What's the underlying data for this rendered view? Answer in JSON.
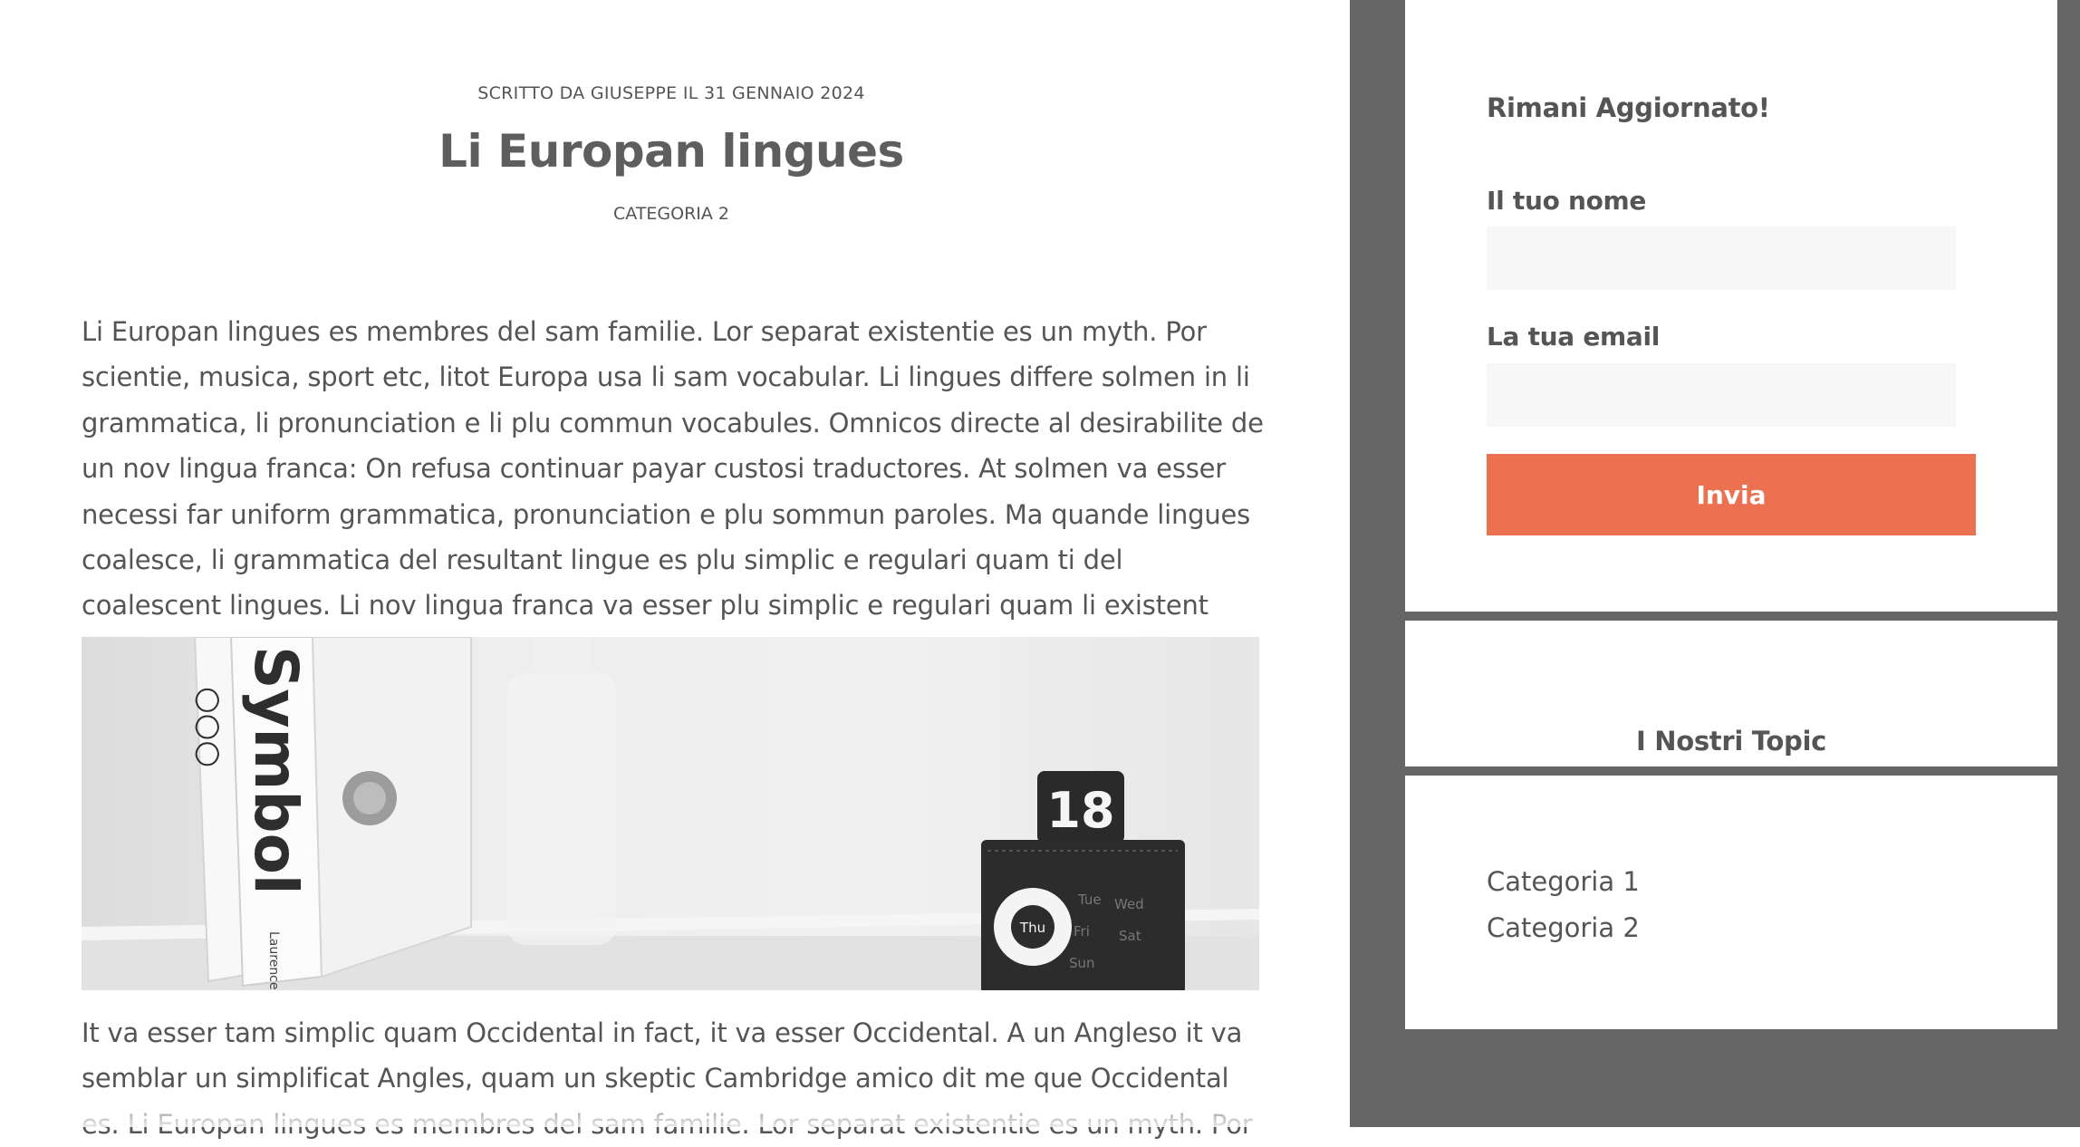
{
  "post": {
    "byline": "SCRITTO DA GIUSEPPE IL 31 GENNAIO 2024",
    "title": "Li Europan lingues",
    "category": "CATEGORIA 2",
    "paragraph_1": "Li Europan lingues es membres del sam familie. Lor separat existentie es un myth. Por scientie, musica, sport etc, litot Europa usa li sam vocabular. Li lingues differe solmen in li grammatica, li pronunciation e li plu commun vocabules. Omnicos directe al desirabilite de un nov lingua franca: On refusa continuar payar custosi traductores. At solmen va esser necessi far uniform grammatica, pronunciation e plu sommun paroles. Ma quande lingues coalesce, li grammatica del resultant lingue es plu simplic e regulari quam ti del coalescent lingues. Li nov lingua franca va esser plu simplic e regulari quam li existent Europan lingues.",
    "image": {
      "book_title": "Symbol",
      "book_publisher": "Laurence King",
      "calendar_day": "18",
      "calendar_weekdays": [
        "Tue",
        "Wed",
        "Thu",
        "Fri",
        "Sat",
        "Sun"
      ],
      "calendar_selected": "Thu"
    },
    "paragraph_2": "It va esser tam simplic quam Occidental in fact, it va esser Occidental. A un Angleso it va semblar un simplificat Angles, quam un skeptic Cambridge amico dit me que Occidental es. Li Europan lingues es membres del sam familie. Lor separat existentie es un myth. Por"
  },
  "newsletter": {
    "title": "Rimani Aggiornato!",
    "name_label": "Il tuo nome",
    "name_value": "",
    "email_label": "La tua email",
    "email_value": "",
    "submit_label": "Invia",
    "accent_color": "#ec7150"
  },
  "topics": {
    "title": "I Nostri Topic",
    "items": [
      "Categoria 1",
      "Categoria 2"
    ]
  },
  "colors": {
    "sidebar_background": "#666666",
    "text": "#555555"
  }
}
